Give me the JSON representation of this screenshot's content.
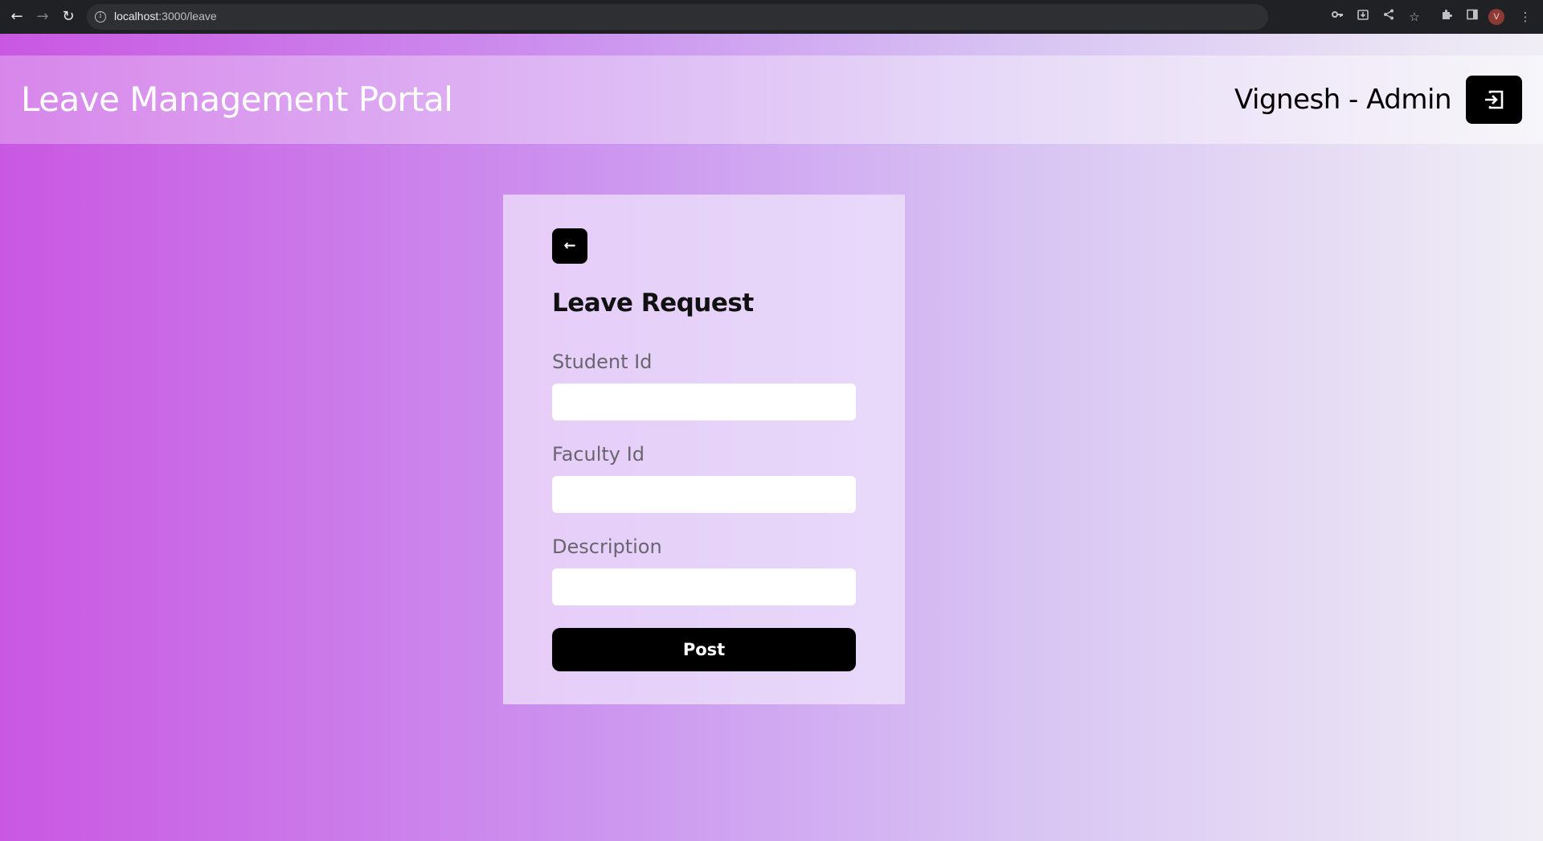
{
  "browser": {
    "url_host": "localhost",
    "url_path": ":3000/leave"
  },
  "header": {
    "title": "Leave Management Portal",
    "user": "Vignesh - Admin"
  },
  "form": {
    "title": "Leave Request",
    "fields": [
      {
        "label": "Student Id",
        "value": ""
      },
      {
        "label": "Faculty Id",
        "value": ""
      },
      {
        "label": "Description",
        "value": ""
      }
    ],
    "submit_label": "Post"
  },
  "colors": {
    "gradient_start": "#c957e2",
    "gradient_end": "#f0eef5",
    "button": "#000000"
  },
  "icons": {
    "back": "arrow-left-icon",
    "logout": "logout-icon"
  }
}
